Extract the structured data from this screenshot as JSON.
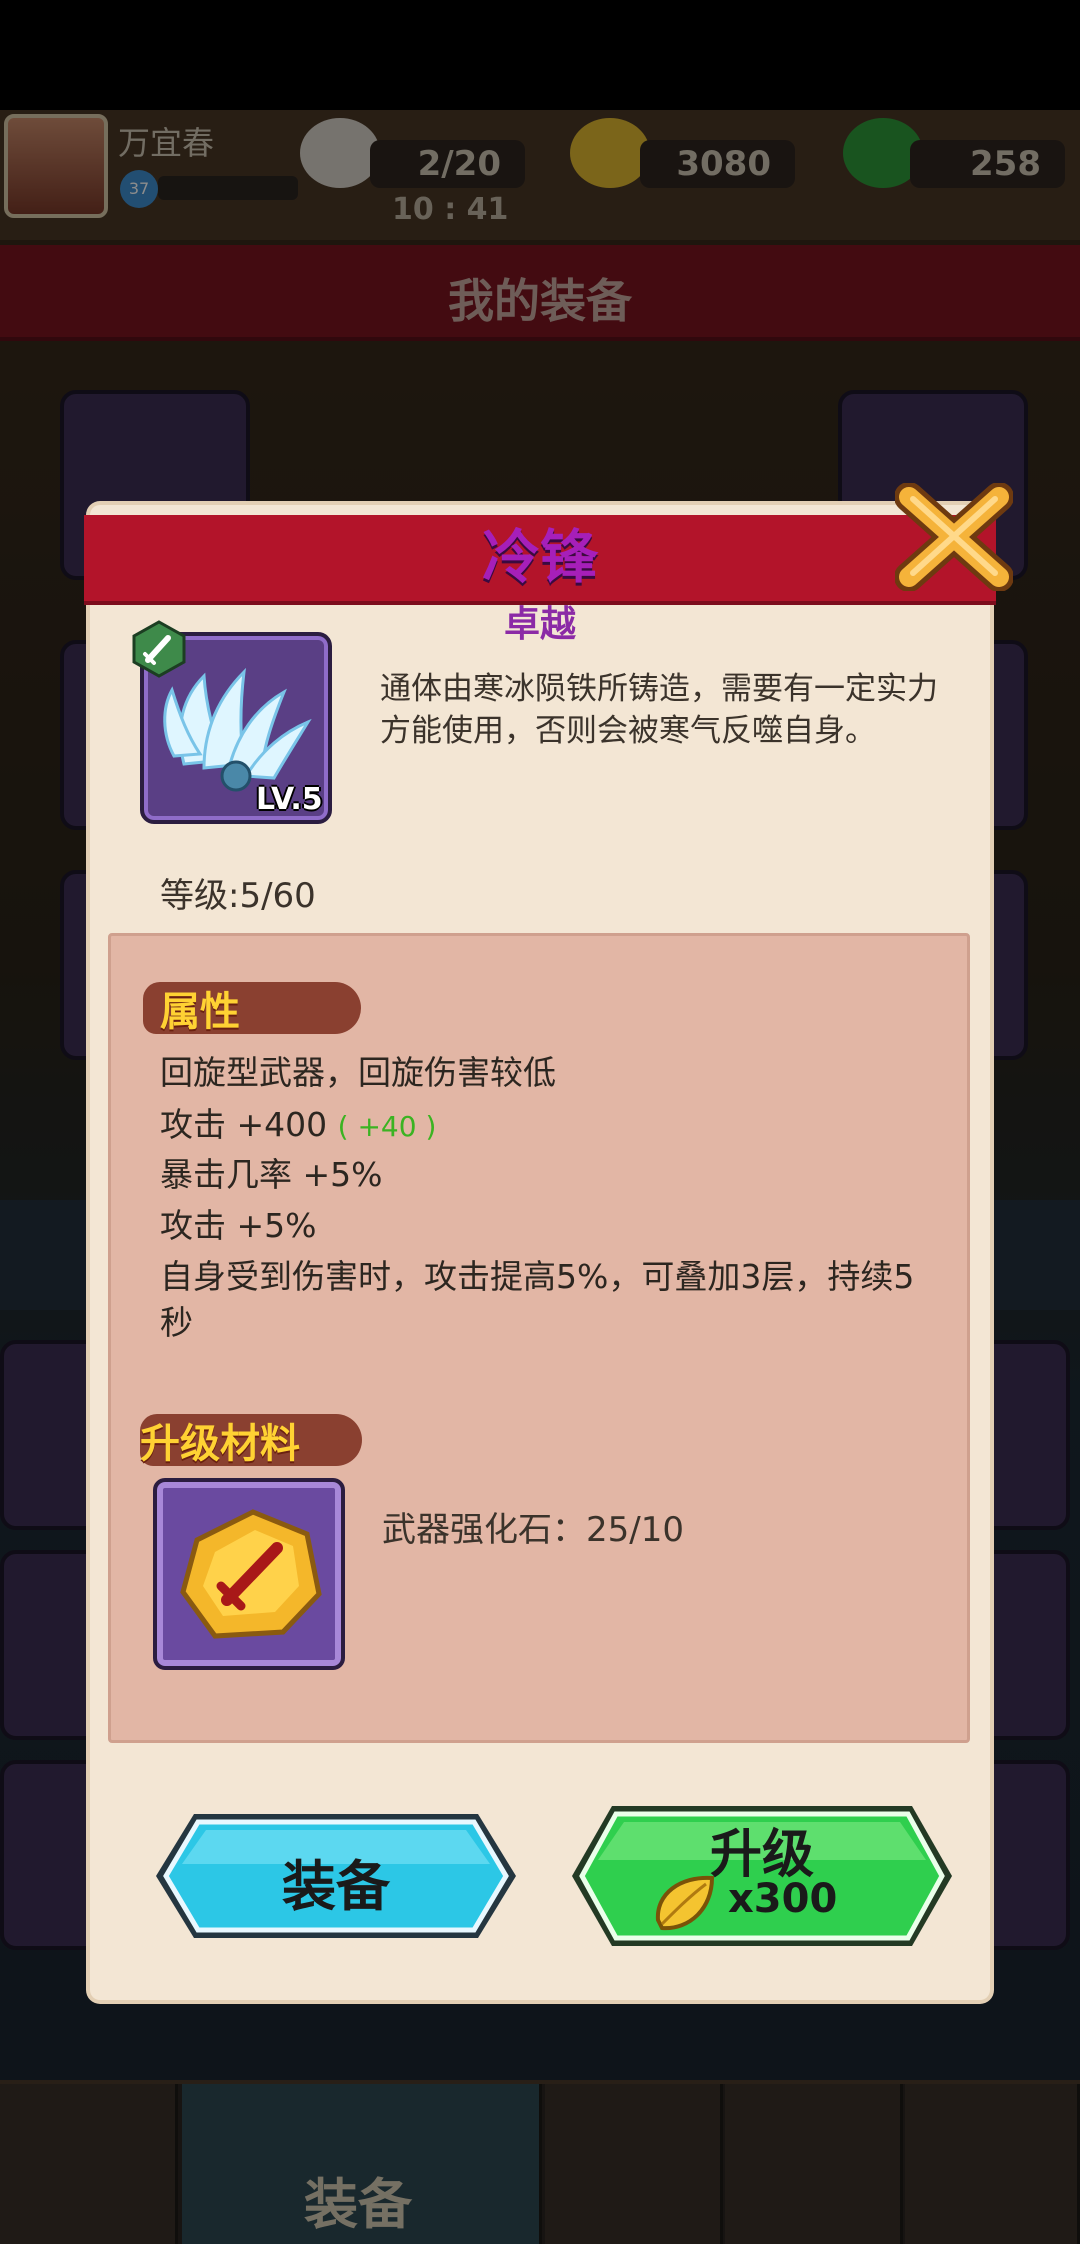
{
  "player": {
    "name": "万宜春",
    "level": "37"
  },
  "resources": {
    "stamina": "2/20",
    "stamina_timer": "10 : 41",
    "gold": "3080",
    "gems": "258"
  },
  "page": {
    "title": "我的装备"
  },
  "modal": {
    "item_name": "冷锋",
    "quality": "卓越",
    "item_level_badge": "LV.5",
    "description": "通体由寒冰陨铁所铸造，需要有一定实力方能使用，否则会被寒气反噬自身。",
    "grade": "等级:5/60",
    "attributes_title": "属性",
    "attributes": [
      {
        "text": "回旋型武器，回旋伤害较低",
        "bonus": ""
      },
      {
        "text": "攻击 +400",
        "bonus": "( +40 )"
      },
      {
        "text": "暴击几率 +5%",
        "bonus": ""
      },
      {
        "text": "攻击 +5%",
        "bonus": ""
      },
      {
        "text": "自身受到伤害时，攻击提高5%，可叠加3层，持续5秒",
        "bonus": ""
      }
    ],
    "materials_title": "升级材料",
    "material_text": "武器强化石：25/10",
    "equip_label": "装备",
    "upgrade_label": "升级",
    "upgrade_cost": "x300"
  },
  "bottom_nav": {
    "active_label": "装备"
  },
  "colors": {
    "title_purple": "#a61fb9",
    "header_red": "#b3142a",
    "panel_pink": "#e2b6a5",
    "equip_blue": "#2cc7e6",
    "upgrade_green": "#2fcf4e",
    "section_yellow": "#ffd233"
  }
}
